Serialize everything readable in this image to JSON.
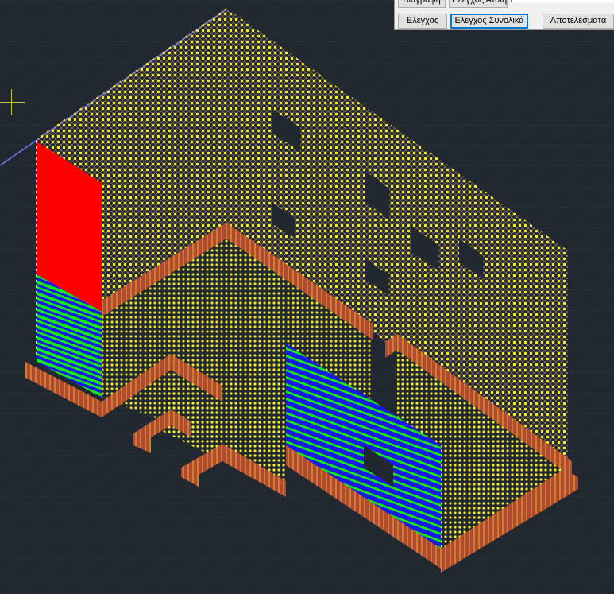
{
  "toolbar": {
    "delete_label": "Διαγραφή",
    "simple_check_label": "Ελεγχος Απλή",
    "check_label": "Ελεγχος",
    "total_check_label": "Ελεγχος Συνολικά",
    "results_label": "Αποτελέσματα"
  },
  "colors": {
    "background": "#212830",
    "grid": "#2c343d",
    "mesh_dots": "#f5ec2a",
    "mesh_lines": "#d9a67a",
    "foundation": "#b14a34",
    "foundation_hatch": "#f0b024",
    "red_region": "#ff0000",
    "stripe_blue": "#1a1ae6",
    "stripe_green": "#19e619",
    "edge_line": "#7a7af0"
  },
  "icons": {
    "cursor": "crosshair-cursor-icon"
  }
}
